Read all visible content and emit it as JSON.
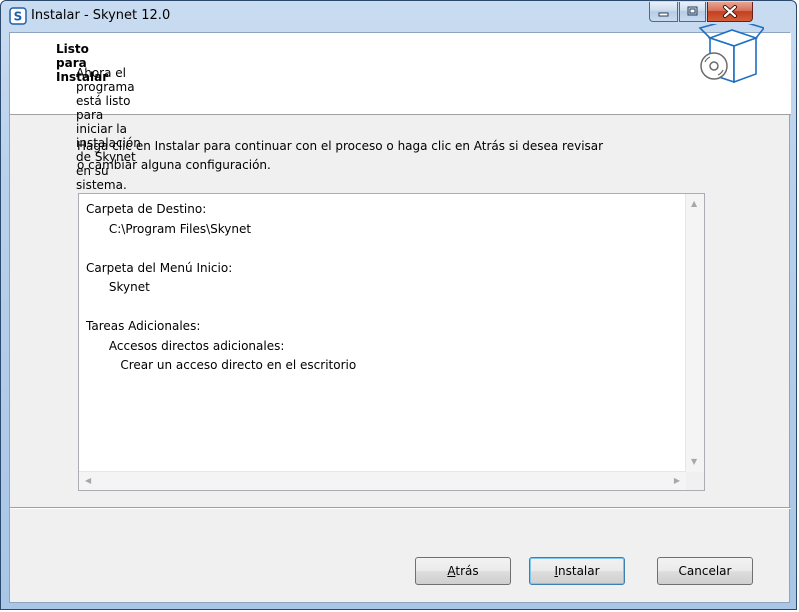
{
  "window": {
    "title": "Instalar - Skynet 12.0",
    "app_icon": "skynet-logo-icon",
    "controls": [
      "minimize-icon",
      "maximize-icon",
      "close-icon"
    ]
  },
  "header": {
    "title": "Listo para Instalar",
    "subtitle": "Ahora el programa está listo para iniciar la instalación de Skynet en su sistema.",
    "art_icon": "package-disc-icon"
  },
  "instructions": {
    "line1": "Haga clic en Instalar para continuar con el proceso o haga clic en Atrás si desea revisar",
    "line2": "o cambiar alguna configuración."
  },
  "summary": {
    "lines": [
      "Carpeta de Destino:",
      "      C:\\Program Files\\Skynet",
      "",
      "Carpeta del Menú Inicio:",
      "      Skynet",
      "",
      "Tareas Adicionales:",
      "      Accesos directos adicionales:",
      "         Crear un acceso directo en el escritorio"
    ]
  },
  "buttons": {
    "back": {
      "accel": "A",
      "rest": "trás"
    },
    "install": {
      "accel": "I",
      "rest": "nstalar"
    },
    "cancel": "Cancelar"
  },
  "colors": {
    "title_bar": "#b9d1ec",
    "close_button": "#c2401f",
    "dialog_background": "#f0f0f0",
    "default_button_border": "#3c7fb1"
  }
}
